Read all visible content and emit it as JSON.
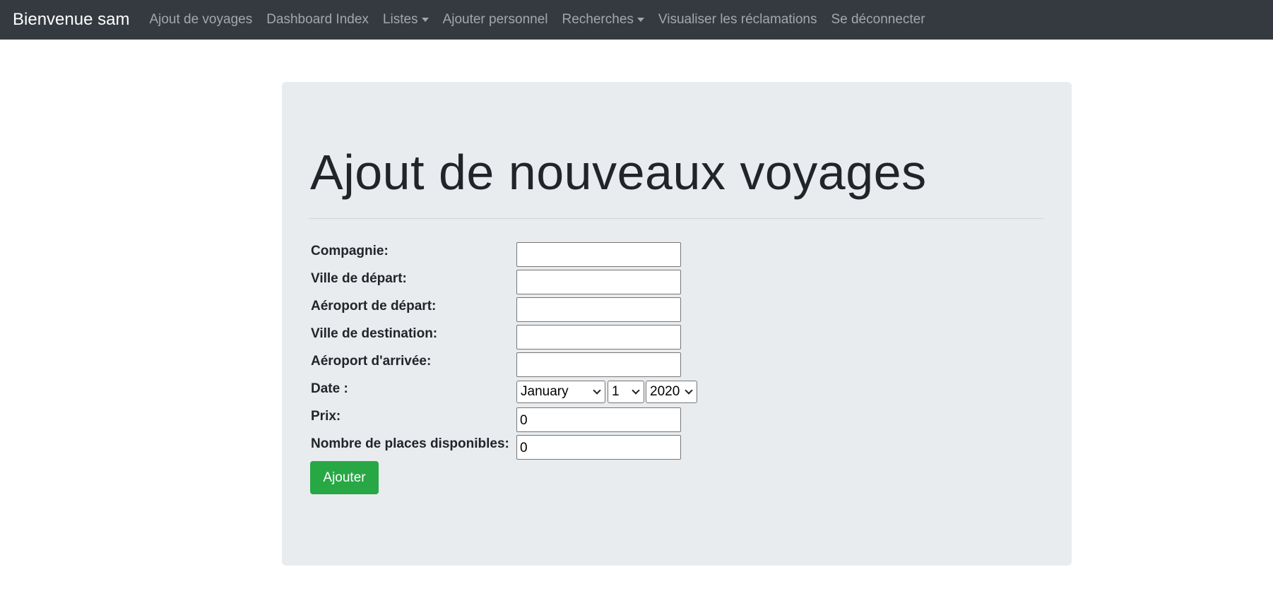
{
  "navbar": {
    "brand": "Bienvenue sam",
    "links": [
      {
        "label": "Ajout de voyages"
      },
      {
        "label": "Dashboard Index"
      },
      {
        "label": "Listes",
        "dropdown": true
      },
      {
        "label": "Ajouter personnel"
      },
      {
        "label": "Recherches",
        "dropdown": true
      },
      {
        "label": "Visualiser les réclamations"
      },
      {
        "label": "Se déconnecter"
      }
    ]
  },
  "page": {
    "title": "Ajout de nouveaux voyages"
  },
  "form": {
    "compagnie": {
      "label": "Compagnie:",
      "value": ""
    },
    "ville_depart": {
      "label": "Ville de départ:",
      "value": ""
    },
    "aeroport_depart": {
      "label": "Aéroport de départ:",
      "value": ""
    },
    "ville_destination": {
      "label": "Ville de destination:",
      "value": ""
    },
    "aeroport_arrivee": {
      "label": "Aéroport d'arrivée:",
      "value": ""
    },
    "date": {
      "label": "Date :",
      "month": "January",
      "day": "1",
      "year": "2020"
    },
    "prix": {
      "label": "Prix:",
      "value": "0"
    },
    "places": {
      "label": "Nombre de places disponibles:",
      "value": "0"
    },
    "submit_label": "Ajouter"
  },
  "colors": {
    "navbar_bg": "#343a40",
    "jumbotron_bg": "#e9ecef",
    "submit_bg": "#28a745"
  },
  "icons": {
    "dropdown": "caret-down-icon",
    "select": "chevron-down-icon"
  }
}
